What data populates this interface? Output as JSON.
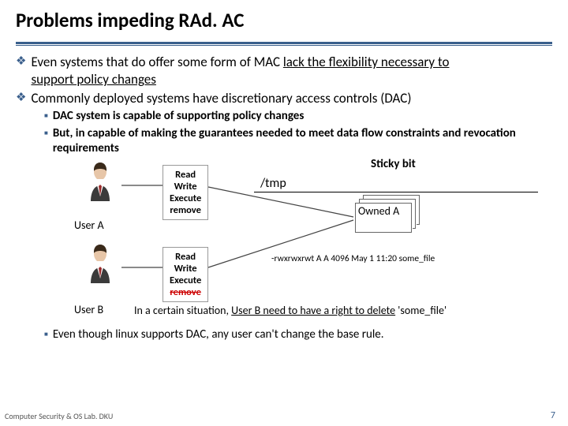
{
  "title": "Problems impeding RAd. AC",
  "bullets": {
    "l1a_pre": "Even systems that do offer some form of MAC ",
    "l1a_u1": "lack the flexibility necessary to",
    "l1a_u2": "support policy changes",
    "l1b": "Commonly deployed systems have discretionary access controls (DAC)",
    "l2a": "DAC system is capable of supporting policy changes",
    "l2b": "But, in capable of making the guarantees needed to meet data flow constraints and revocation requirements",
    "l3": "Even though linux supports DAC, any user can't change the base rule."
  },
  "diagram": {
    "userA": "User A",
    "userB": "User B",
    "perm": {
      "read": "Read",
      "write": "Write",
      "exec": "Execute",
      "remove": "remove"
    },
    "sticky": "Sticky bit",
    "tmp": "/tmp",
    "owned": "Owned A",
    "ls": "-rwxrwxrwt   A   A   4096   May 1 11:20 some_file",
    "situation_pre": "In a certain situation, ",
    "situation_u": "User B need to have a right to delete",
    "situation_post": " 'some_file'"
  },
  "footer": {
    "left": "Computer Security & OS Lab. DKU",
    "page": "7"
  }
}
